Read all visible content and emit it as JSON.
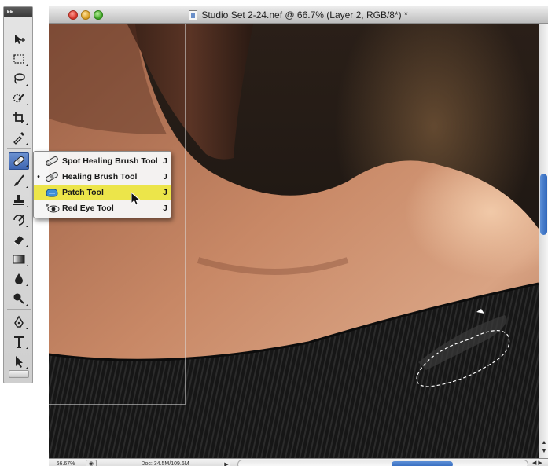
{
  "window": {
    "title": "Studio Set 2-24.nef @ 66.7% (Layer 2, RGB/8*) *"
  },
  "tools_panel": {
    "header_glyph": "▸▸",
    "tools": [
      {
        "id": "move",
        "icon": "move-icon"
      },
      {
        "id": "marquee",
        "icon": "rectangular-marquee-icon"
      },
      {
        "id": "lasso",
        "icon": "lasso-icon"
      },
      {
        "id": "quick-selection",
        "icon": "quick-selection-icon"
      },
      {
        "id": "crop",
        "icon": "crop-icon"
      },
      {
        "id": "eyedropper",
        "icon": "eyedropper-icon"
      },
      {
        "id": "healing",
        "icon": "band-aid-icon",
        "active": true
      },
      {
        "id": "brush",
        "icon": "brush-icon"
      },
      {
        "id": "clone-stamp",
        "icon": "stamp-icon"
      },
      {
        "id": "history-brush",
        "icon": "history-brush-icon"
      },
      {
        "id": "eraser",
        "icon": "eraser-icon"
      },
      {
        "id": "gradient",
        "icon": "gradient-icon"
      },
      {
        "id": "blur",
        "icon": "blur-drop-icon"
      },
      {
        "id": "dodge",
        "icon": "dodge-icon"
      },
      {
        "id": "pen",
        "icon": "pen-icon"
      },
      {
        "id": "type",
        "icon": "type-icon"
      },
      {
        "id": "path-selection",
        "icon": "path-selection-arrow-icon"
      }
    ]
  },
  "flyout": {
    "items": [
      {
        "label": "Spot Healing Brush Tool",
        "shortcut": "J",
        "checked": false,
        "highlighted": false,
        "icon": "spot-healing-icon"
      },
      {
        "label": "Healing Brush Tool",
        "shortcut": "J",
        "checked": true,
        "highlighted": false,
        "icon": "healing-brush-icon"
      },
      {
        "label": "Patch Tool",
        "shortcut": "J",
        "checked": false,
        "highlighted": true,
        "icon": "patch-icon"
      },
      {
        "label": "Red Eye Tool",
        "shortcut": "J",
        "checked": false,
        "highlighted": false,
        "icon": "red-eye-icon"
      }
    ],
    "check_glyph": "•"
  },
  "status_bar": {
    "zoom": "66.67%",
    "doc_size": "Doc: 34.5M/109.6M",
    "arrow_glyph": "▶",
    "scroll_arrows": "◀ ▶"
  },
  "colors": {
    "menu_highlight": "#ece54a",
    "active_tool": "#3f66b2",
    "scroll_thumb": "#2f66bb"
  }
}
